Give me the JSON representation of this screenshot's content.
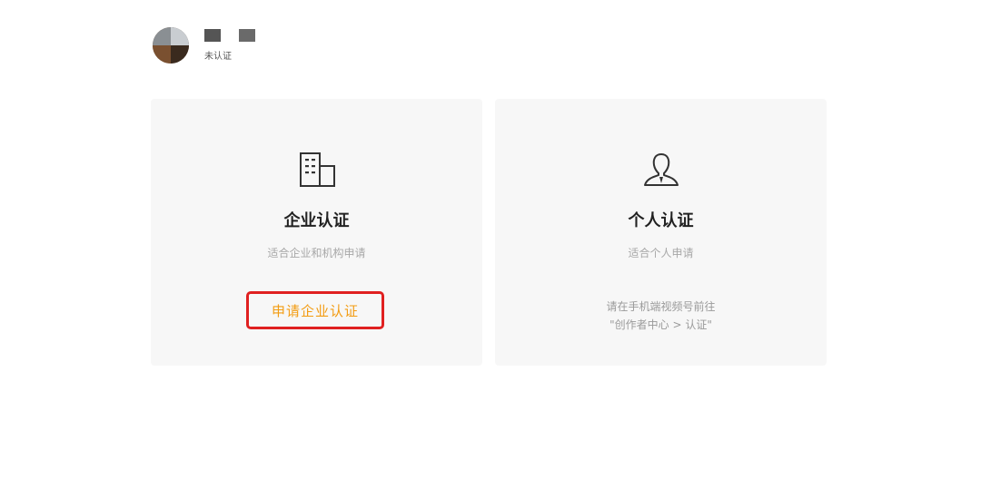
{
  "user": {
    "status": "未认证"
  },
  "cards": {
    "enterprise": {
      "icon": "building-icon",
      "title": "企业认证",
      "description": "适合企业和机构申请",
      "button_label": "申请企业认证"
    },
    "personal": {
      "icon": "person-icon",
      "title": "个人认证",
      "description": "适合个人申请",
      "note_line1": "请在手机端视频号前往",
      "note_line2": "\"创作者中心 > 认证\""
    }
  },
  "colors": {
    "accent": "#f39c12",
    "highlight_border": "#e02020",
    "card_bg": "#f7f7f7"
  }
}
